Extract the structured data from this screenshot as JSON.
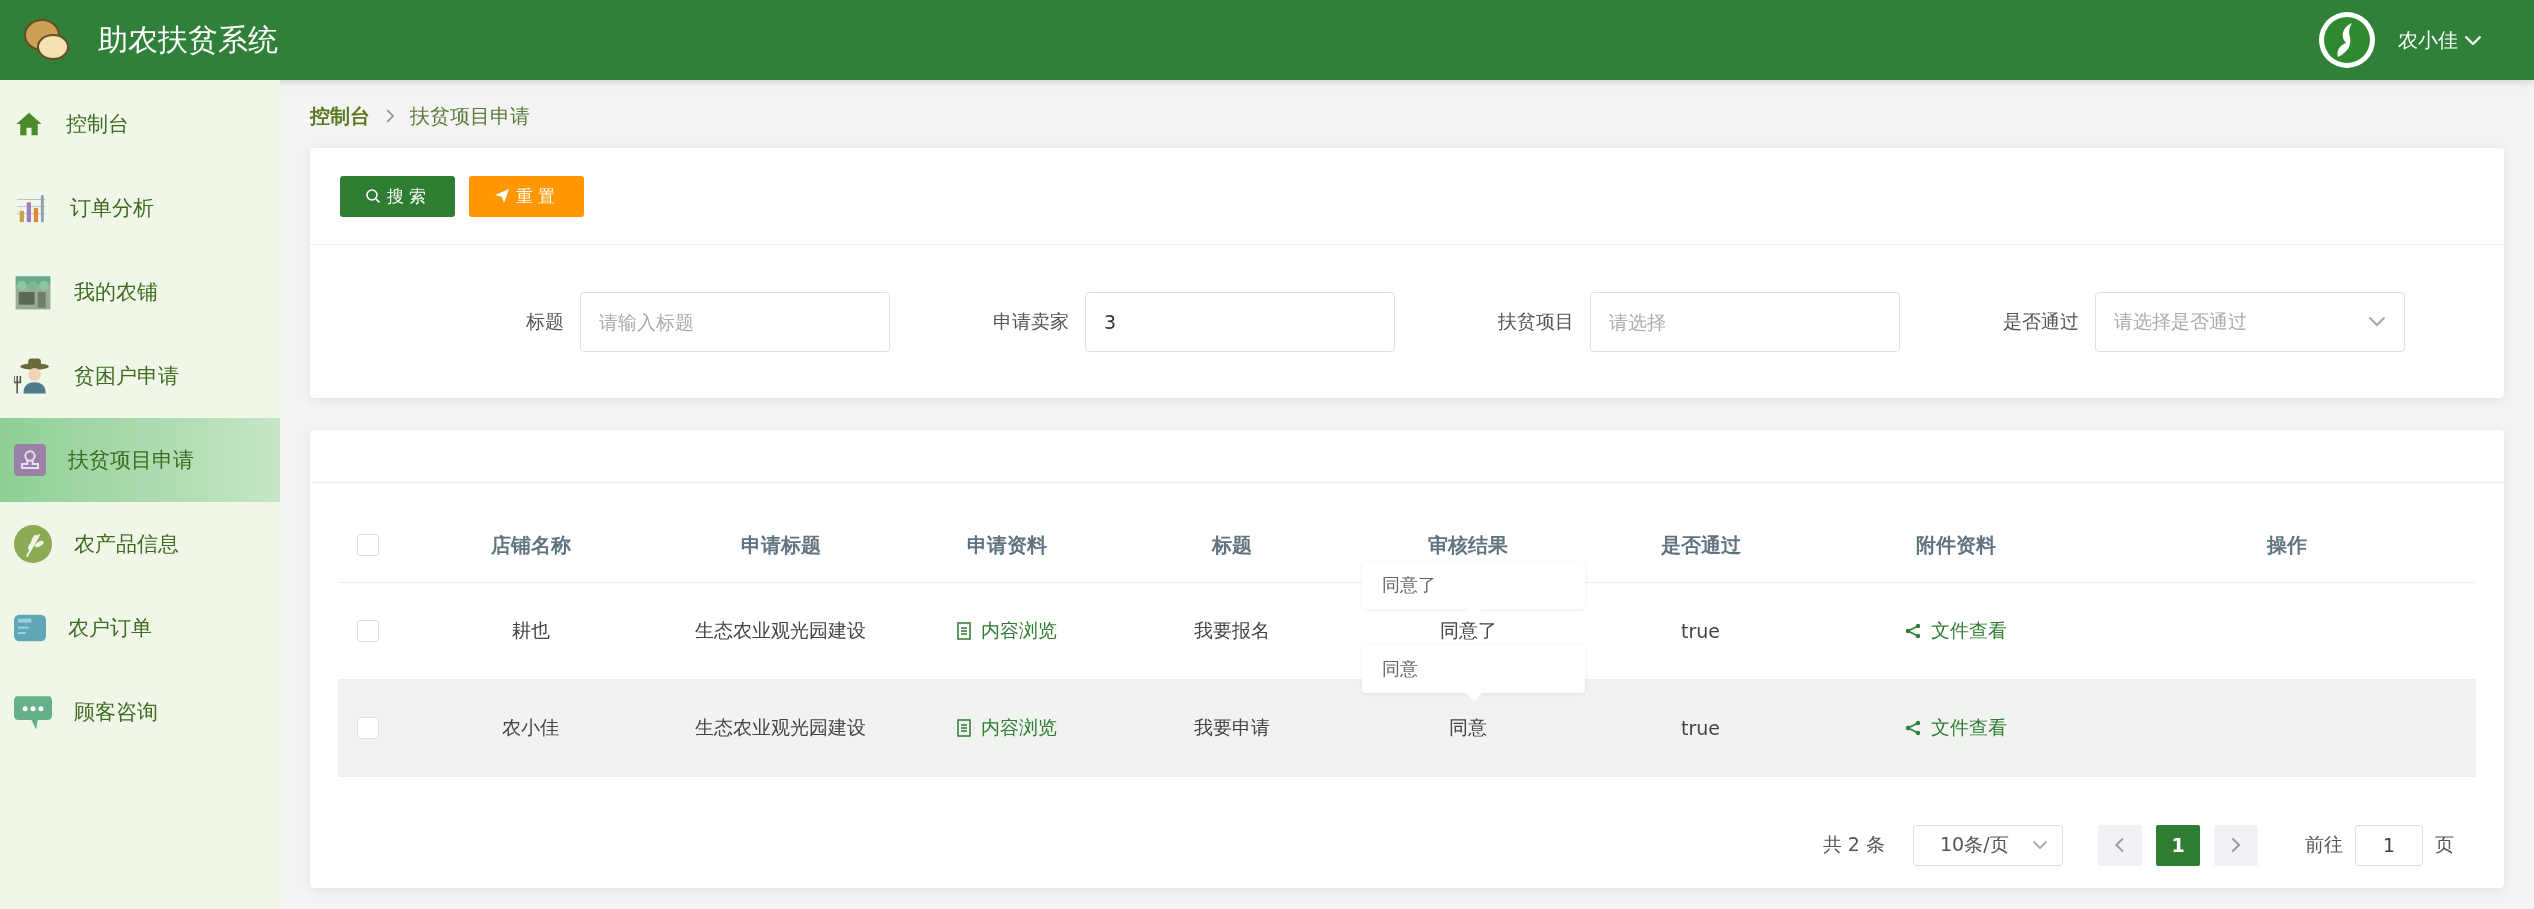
{
  "header": {
    "title": "助农扶贫系统",
    "user": "农小佳"
  },
  "sidebar": {
    "items": [
      {
        "label": "控制台",
        "selected": false
      },
      {
        "label": "订单分析",
        "selected": false
      },
      {
        "label": "我的农铺",
        "selected": false
      },
      {
        "label": "贫困户申请",
        "selected": false
      },
      {
        "label": "扶贫项目申请",
        "selected": true
      },
      {
        "label": "农产品信息",
        "selected": false
      },
      {
        "label": "农户订单",
        "selected": false
      },
      {
        "label": "顾客咨询",
        "selected": false
      }
    ]
  },
  "breadcrumb": [
    {
      "label": "控制台"
    },
    {
      "label": "扶贫项目申请"
    }
  ],
  "actions": [
    {
      "label": "搜索",
      "kind": "search"
    },
    {
      "label": "重置",
      "kind": "reset"
    }
  ],
  "filters": [
    {
      "label": "标题",
      "kind": "input",
      "placeholder": "请输入标题"
    },
    {
      "label": "申请卖家",
      "kind": "input",
      "value": "3"
    },
    {
      "label": "扶贫项目",
      "kind": "input",
      "placeholder": "请选择"
    },
    {
      "label": "是否通过",
      "kind": "select",
      "placeholder": "请选择是否通过"
    }
  ],
  "table": {
    "all_checked": false,
    "columns": [
      "店铺名称",
      "申请标题",
      "申请资料",
      "标题",
      "审核结果",
      "是否通过",
      "附件资料",
      "操作"
    ],
    "rows": [
      {
        "checked": false,
        "hovered": false,
        "shop": "耕也",
        "apply_title": "生态农业观光园建设",
        "material": "内容浏览",
        "title": "我要报名",
        "result": "同意了",
        "passed": "true",
        "attachment": "文件查看"
      },
      {
        "checked": false,
        "hovered": true,
        "shop": "农小佳",
        "apply_title": "生态农业观光园建设",
        "material": "内容浏览",
        "title": "我要申请",
        "result": "同意",
        "passed": "true",
        "attachment": "文件查看"
      }
    ]
  },
  "popovers": [
    {
      "text": "同意了"
    },
    {
      "text": "同意"
    }
  ],
  "pagination": {
    "total": "共 2 条",
    "page_size": "10条/页",
    "pages": [
      {
        "label": "1",
        "selected": true
      }
    ],
    "goto_label": "前往",
    "goto_value": "1",
    "goto_suffix": "页"
  }
}
